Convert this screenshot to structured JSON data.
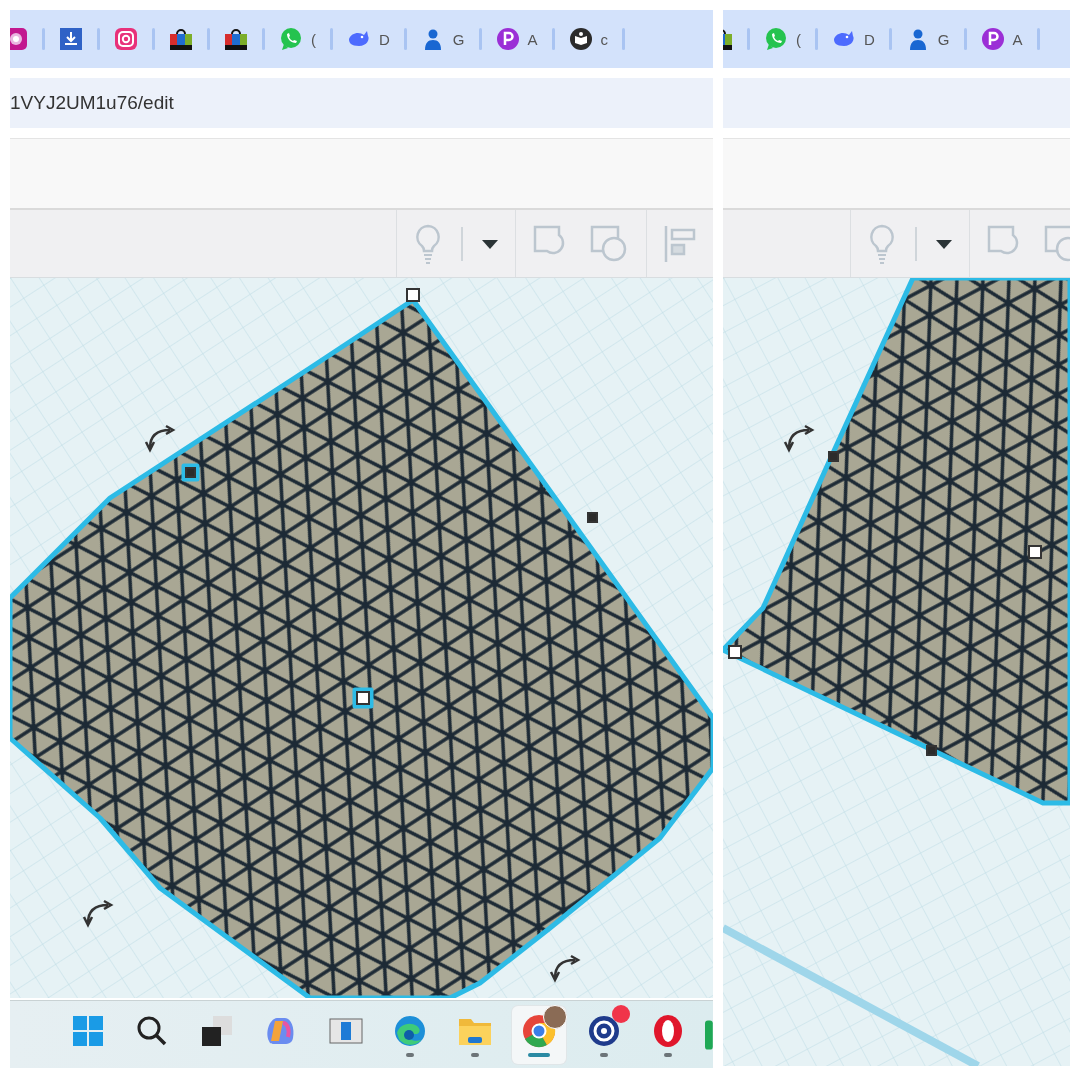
{
  "panels": [
    {
      "bookmark_labels": [
        "(",
        "D",
        "G",
        "A",
        "c"
      ],
      "address": "1VYJ2UM1u76/edit",
      "taskbar": [
        {
          "running": false,
          "selected": false
        },
        {
          "running": false,
          "selected": false
        },
        {
          "running": false,
          "selected": false
        },
        {
          "running": false,
          "selected": false
        },
        {
          "running": false,
          "selected": false
        },
        {
          "running": true,
          "selected": false
        },
        {
          "running": true,
          "selected": false
        },
        {
          "running": true,
          "selected": true
        },
        {
          "running": true,
          "selected": false
        },
        {
          "running": true,
          "selected": false
        }
      ]
    },
    {
      "bookmark_labels": [
        "(",
        "D",
        "G",
        "A"
      ]
    }
  ]
}
